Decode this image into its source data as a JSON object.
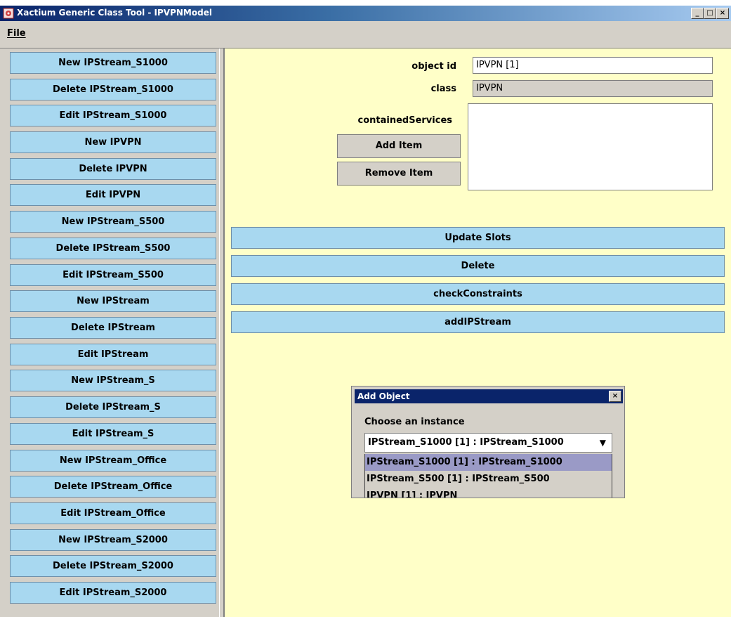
{
  "window": {
    "title": "Xactium Generic Class Tool - IPVPNModel",
    "minimize": "_",
    "maximize": "□",
    "close": "×"
  },
  "menu": {
    "file": "File"
  },
  "sidebar": {
    "buttons": [
      "New IPStream_S1000",
      "Delete IPStream_S1000",
      "Edit IPStream_S1000",
      "New IPVPN",
      "Delete IPVPN",
      "Edit IPVPN",
      "New IPStream_S500",
      "Delete IPStream_S500",
      "Edit IPStream_S500",
      "New IPStream",
      "Delete IPStream",
      "Edit IPStream",
      "New IPStream_S",
      "Delete IPStream_S",
      "Edit IPStream_S",
      "New IPStream_Office",
      "Delete IPStream_Office",
      "Edit IPStream_Office",
      "New IPStream_S2000",
      "Delete IPStream_S2000",
      "Edit IPStream_S2000"
    ]
  },
  "form": {
    "object_id_label": "object id",
    "object_id_value": "IPVPN [1]",
    "class_label": "class",
    "class_value": "IPVPN",
    "contained_label": "containedServices",
    "add_item": "Add Item",
    "remove_item": "Remove Item"
  },
  "actions": [
    "Update Slots",
    "Delete",
    "checkConstraints",
    "addIPStream"
  ],
  "dialog": {
    "title": "Add Object",
    "close": "×",
    "prompt": "Choose an instance",
    "selected": "IPStream_S1000 [1] : IPStream_S1000",
    "options": [
      "IPStream_S1000 [1] : IPStream_S1000",
      "IPStream_S500 [1] : IPStream_S500",
      "IPVPN [1] : IPVPN"
    ],
    "highlighted_index": 0
  },
  "colors": {
    "blue_button": "#a8d8f0",
    "panel_yellow": "#ffffc8",
    "selection": "#9a9ac6"
  }
}
